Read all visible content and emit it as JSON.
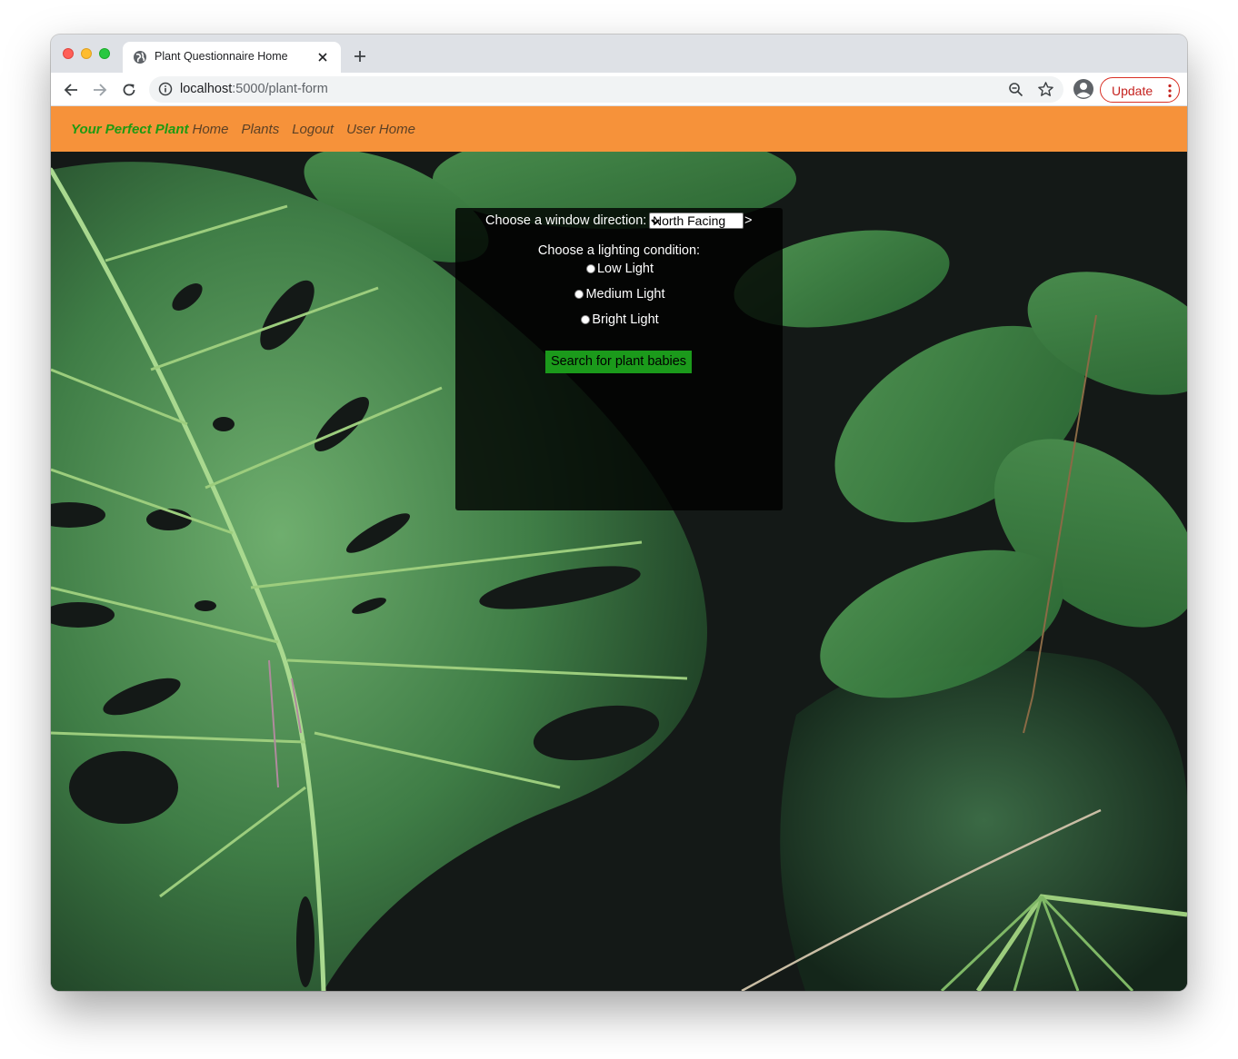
{
  "browser": {
    "tab_title": "Plant Questionnaire Home",
    "url_host": "localhost",
    "url_rest": ":5000/plant-form",
    "update_label": "Update"
  },
  "navbar": {
    "brand": "Your Perfect Plant",
    "links": [
      "Home",
      "Plants",
      "Logout",
      "User Home"
    ]
  },
  "form": {
    "direction_label": "Choose a window direction:",
    "direction_value": "North Facing",
    "direction_trailing": ">",
    "lighting_label": "Choose a lighting condition:",
    "lighting_options": [
      "Low Light",
      "Medium Light",
      "Bright Light"
    ],
    "submit_label": "Search for plant babies"
  },
  "colors": {
    "navbar_bg": "#f6923a",
    "brand": "#1f9a12",
    "submit_bg": "#1b9a1b"
  }
}
